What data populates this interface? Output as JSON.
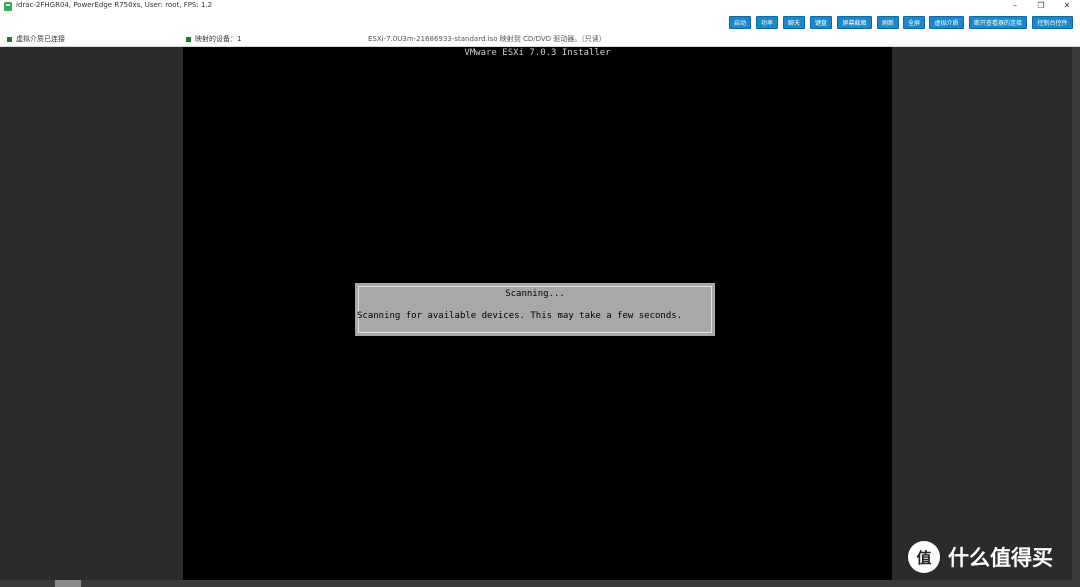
{
  "window": {
    "title": "idrac-2FHGR04, PowerEdge R750xs, User: root, FPS: 1.2",
    "controls": {
      "minimize": "–",
      "restore": "❐",
      "close": "✕"
    }
  },
  "toolbar": {
    "buttons": [
      "启动",
      "功率",
      "聊天",
      "键盘",
      "屏幕截图",
      "刷新",
      "全屏",
      "虚拟介质",
      "断开查看器的连接",
      "控制台控件"
    ]
  },
  "status": {
    "media_connected": "虚拟介质已连接",
    "mapped_devices": "映射的设备：1",
    "iso_text": "ESXi-7.0U3m-21686933-standard.iso 映射到 CD/DVD 驱动器。（只读）"
  },
  "console": {
    "installer_title": "VMware ESXi 7.0.3 Installer",
    "dialog_title": "Scanning...",
    "dialog_message": "Scanning for available devices. This may take a few seconds."
  },
  "watermark": {
    "badge": "值",
    "text": "什么值得买"
  },
  "colors": {
    "button_blue": "#1e88c7",
    "status_green": "#1e7d24",
    "console_bg": "#000000",
    "dialog_gray": "#a8a8a8"
  }
}
